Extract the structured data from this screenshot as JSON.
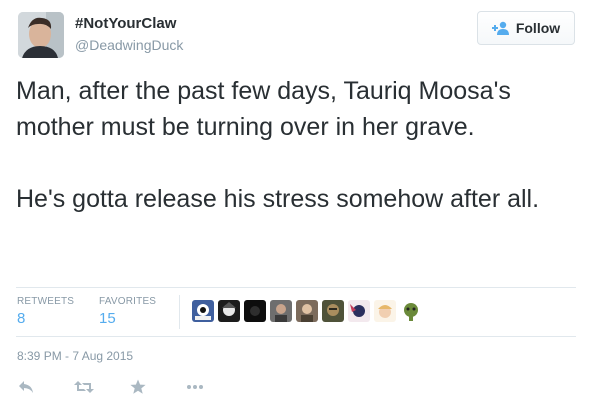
{
  "author": {
    "display_name": "#NotYourClaw",
    "handle": "@DeadwingDuck"
  },
  "follow_button": {
    "label": "Follow"
  },
  "tweet": {
    "paragraphs": [
      "Man, after the past few days, Tauriq Moosa's mother must be turning over in her grave.",
      "He's gotta release his stress somehow after all."
    ]
  },
  "stats": {
    "retweets_label": "RETWEETS",
    "retweets_value": "8",
    "favorites_label": "FAVORITES",
    "favorites_value": "15"
  },
  "timestamp": "8:39 PM - 7 Aug 2015",
  "colors": {
    "link": "#55acee",
    "muted": "#8899a6",
    "action_icon": "#aab8c2"
  },
  "icons": [
    "follow-person-icon",
    "reply-icon",
    "retweet-icon",
    "favorite-icon",
    "more-icon"
  ]
}
